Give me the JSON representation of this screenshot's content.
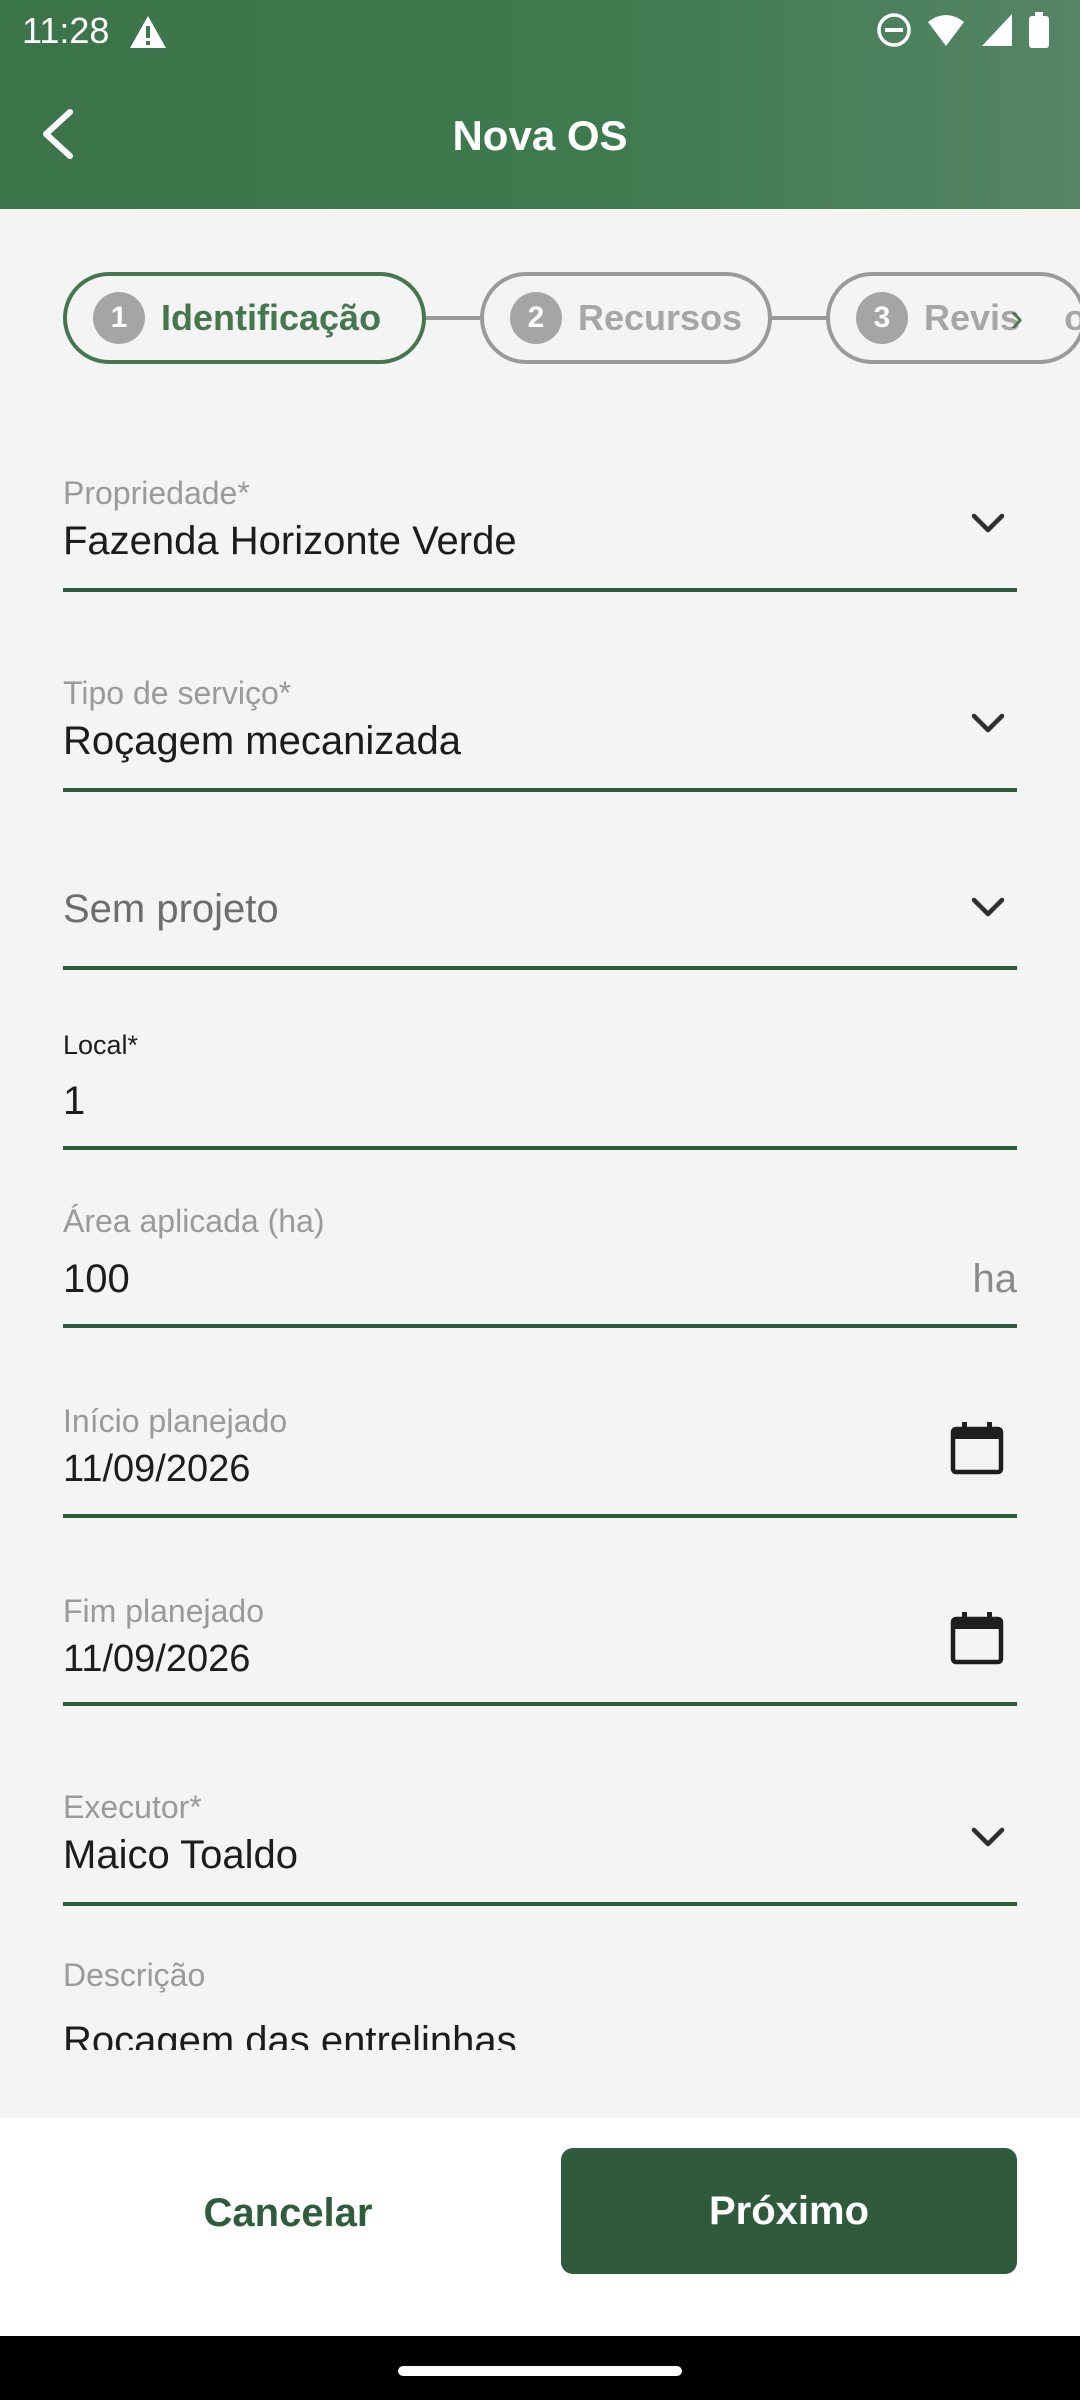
{
  "status": {
    "time": "11:28"
  },
  "app_bar": {
    "title": "Nova OS"
  },
  "stepper": {
    "steps": [
      {
        "num": "1",
        "label": "Identificação"
      },
      {
        "num": "2",
        "label": "Recursos"
      },
      {
        "num": "3",
        "label": "Revis"
      }
    ],
    "overflow_tail": "o"
  },
  "form": {
    "propriedade": {
      "label": "Propriedade*",
      "value": "Fazenda Horizonte Verde"
    },
    "tipo_servico": {
      "label": "Tipo de serviço*",
      "value": "Roçagem mecanizada"
    },
    "projeto": {
      "placeholder": "Sem projeto"
    },
    "local": {
      "label": "Local*",
      "value": "1"
    },
    "area": {
      "label": "Área aplicada (ha)",
      "value": "100",
      "suffix": "ha"
    },
    "inicio": {
      "label": "Início planejado",
      "value": "11/09/2026"
    },
    "fim": {
      "label": "Fim planejado",
      "value": "11/09/2026"
    },
    "executor": {
      "label": "Executor*",
      "value": "Maico Toaldo"
    },
    "descricao": {
      "label": "Descrição",
      "value": "Roçagem das entrelinhas"
    }
  },
  "actions": {
    "cancel": "Cancelar",
    "next": "Próximo"
  },
  "colors": {
    "primary": "#2f5a3b",
    "accent": "#45774f",
    "header": "#3f7a4e"
  }
}
